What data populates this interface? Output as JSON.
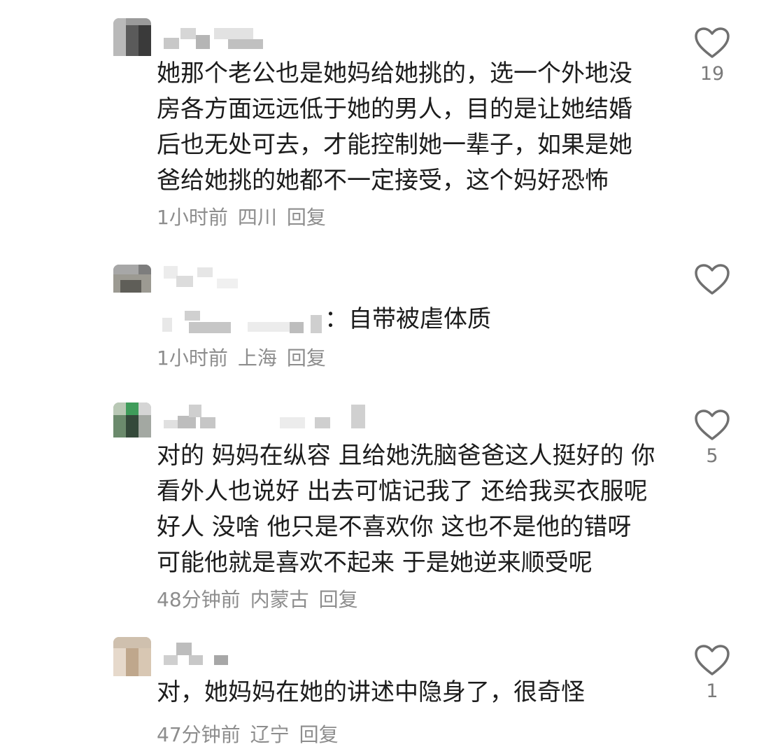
{
  "comments": [
    {
      "text": "她那个老公也是她妈给她挑的，选一个外地没房各方面远远低于她的男人，目的是让她结婚后也无处可去，才能控制她一辈子，如果是她爸给她挑的她都不一定接受，这个妈好恐怖",
      "time": "1小时前",
      "location": "四川",
      "reply": "回复",
      "likes": "19"
    },
    {
      "quote_text": "：自带被虐体质",
      "time": "1小时前",
      "location": "上海",
      "reply": "回复",
      "likes": ""
    },
    {
      "text": "对的 妈妈在纵容 且给她洗脑爸爸这人挺好的 你看外人也说好 出去可惦记我了 还给我买衣服呢 好人 没啥 他只是不喜欢你 这也不是他的错呀 可能他就是喜欢不起来 于是她逆来顺受呢",
      "time": "48分钟前",
      "location": "内蒙古",
      "reply": "回复",
      "likes": "5"
    },
    {
      "text": "对，她妈妈在她的讲述中隐身了，很奇怪",
      "time": "47分钟前",
      "location": "辽宁",
      "reply": "回复",
      "likes": "1"
    }
  ],
  "icons": {
    "like": "heart-outline-icon"
  },
  "colors": {
    "text": "#1c1c1c",
    "meta": "#8d8d8d",
    "icon": "#707070"
  }
}
